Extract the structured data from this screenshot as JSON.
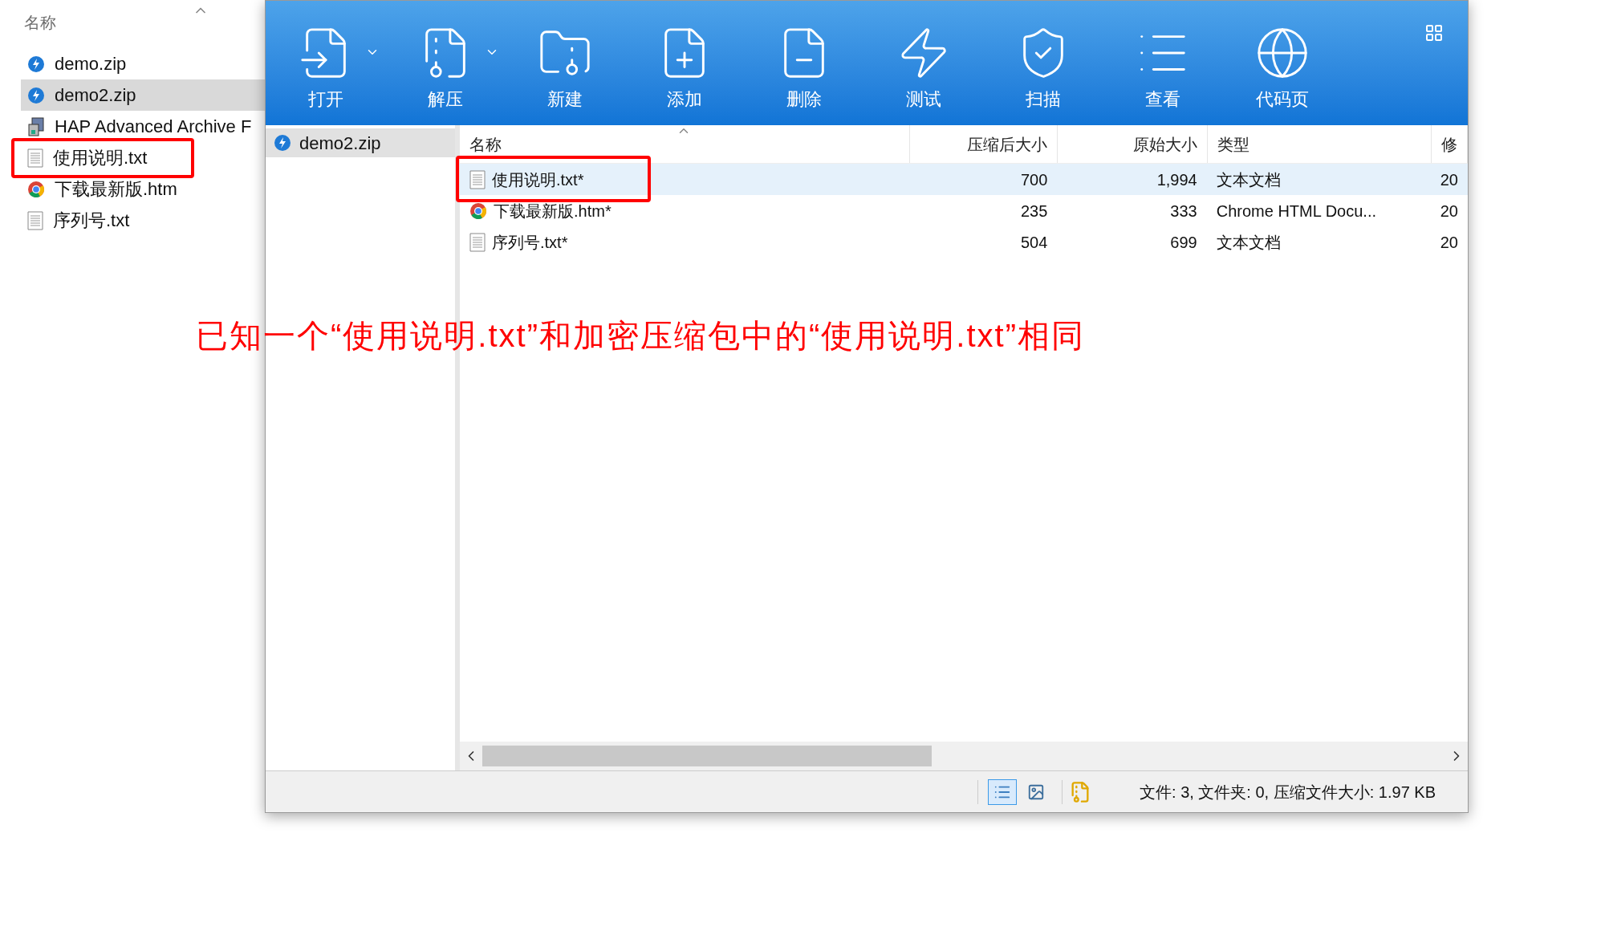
{
  "explorer": {
    "column_header": "名称",
    "items": [
      {
        "name": "demo.zip",
        "kind": "zip",
        "selected": false,
        "highlighted": false
      },
      {
        "name": "demo2.zip",
        "kind": "zip",
        "selected": true,
        "highlighted": false
      },
      {
        "name": "HAP Advanced Archive F",
        "kind": "exe",
        "selected": false,
        "highlighted": false
      },
      {
        "name": "使用说明.txt",
        "kind": "txt",
        "selected": false,
        "highlighted": true
      },
      {
        "name": "下载最新版.htm",
        "kind": "htm",
        "selected": false,
        "highlighted": false
      },
      {
        "name": "序列号.txt",
        "kind": "txt",
        "selected": false,
        "highlighted": false
      }
    ]
  },
  "toolbar": [
    {
      "label": "打开",
      "dropdown": true
    },
    {
      "label": "解压",
      "dropdown": true
    },
    {
      "label": "新建",
      "dropdown": false
    },
    {
      "label": "添加",
      "dropdown": false
    },
    {
      "label": "删除",
      "dropdown": false
    },
    {
      "label": "测试",
      "dropdown": false
    },
    {
      "label": "扫描",
      "dropdown": false
    },
    {
      "label": "查看",
      "dropdown": false
    },
    {
      "label": "代码页",
      "dropdown": false
    }
  ],
  "tree": [
    {
      "name": "demo2.zip",
      "selected": true
    }
  ],
  "table": {
    "columns": [
      "名称",
      "压缩后大小",
      "原始大小",
      "类型",
      "修"
    ],
    "rows": [
      {
        "cells": [
          "使用说明.txt*",
          "700",
          "1,994",
          "文本文档",
          "20"
        ],
        "kind": "txt",
        "selected": true,
        "highlighted": true
      },
      {
        "cells": [
          "下载最新版.htm*",
          "235",
          "333",
          "Chrome HTML Docu...",
          "20"
        ],
        "kind": "htm",
        "selected": false,
        "highlighted": false
      },
      {
        "cells": [
          "序列号.txt*",
          "504",
          "699",
          "文本文档",
          "20"
        ],
        "kind": "txt",
        "selected": false,
        "highlighted": false
      }
    ]
  },
  "annotation": "已知一个“使用说明.txt”和加密压缩包中的“使用说明.txt”相同",
  "status_bar": {
    "view_buttons": [
      {
        "kind": "details",
        "selected": true
      },
      {
        "kind": "thumbnails",
        "selected": false
      }
    ],
    "text": "文件: 3, 文件夹: 0, 压缩文件大小: 1.97 KB"
  }
}
